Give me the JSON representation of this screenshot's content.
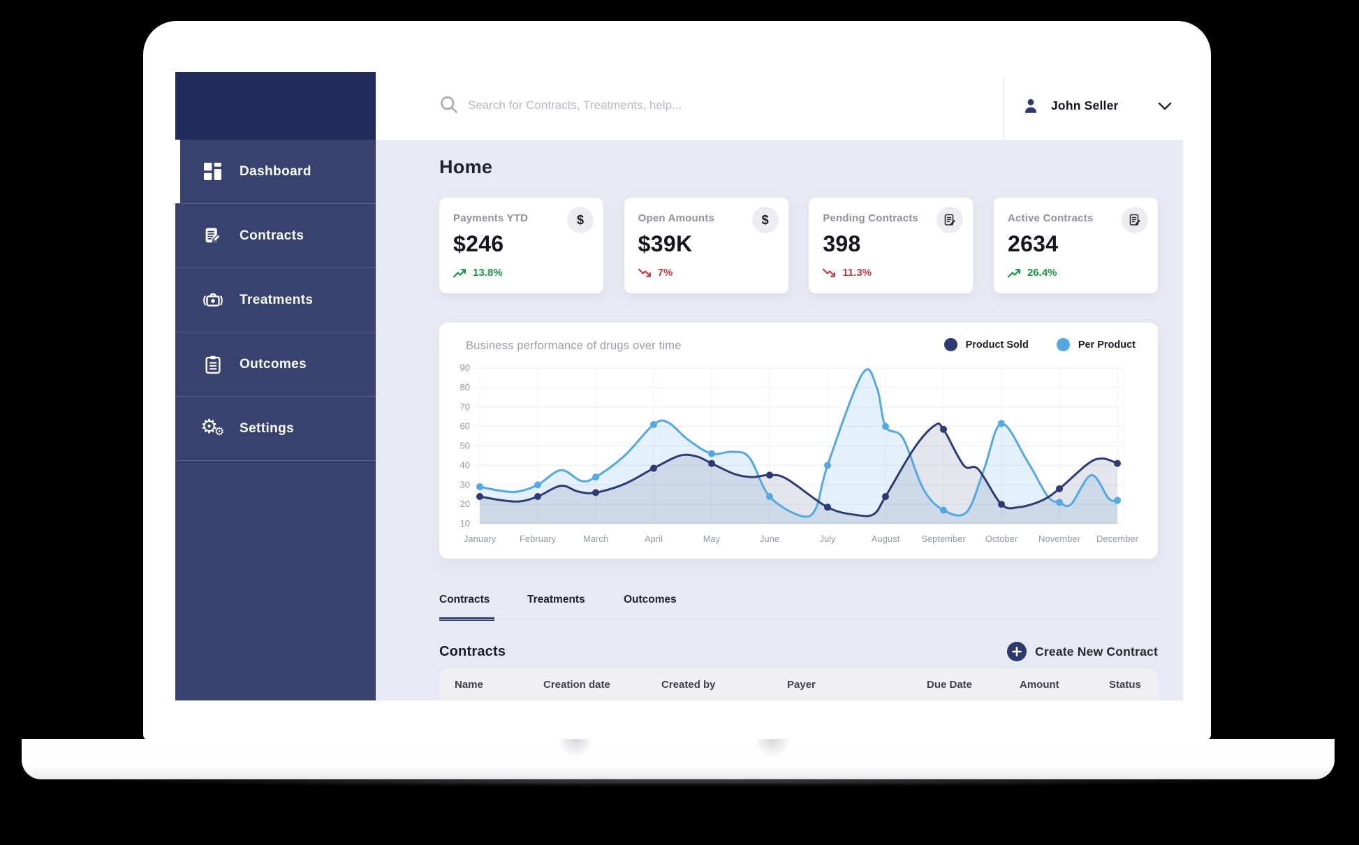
{
  "header": {
    "search_placeholder": "Search for Contracts, Treatments, help...",
    "user_name": "John Seller"
  },
  "sidebar": {
    "items": [
      {
        "label": "Dashboard",
        "icon": "dashboard-grid",
        "active": true
      },
      {
        "label": "Contracts",
        "icon": "contract-edit",
        "active": false
      },
      {
        "label": "Treatments",
        "icon": "medical-bag",
        "active": false
      },
      {
        "label": "Outcomes",
        "icon": "clipboard",
        "active": false
      },
      {
        "label": "Settings",
        "icon": "gears",
        "active": false
      }
    ]
  },
  "page": {
    "title": "Home"
  },
  "stats": [
    {
      "label": "Payments YTD",
      "value": "$246",
      "trend": "13.8%",
      "direction": "up",
      "icon": "dollar-icon"
    },
    {
      "label": "Open Amounts",
      "value": "$39K",
      "trend": "7%",
      "direction": "down",
      "icon": "dollar-icon"
    },
    {
      "label": "Pending Contracts",
      "value": "398",
      "trend": "11.3%",
      "direction": "down",
      "icon": "contract-icon"
    },
    {
      "label": "Active Contracts",
      "value": "2634",
      "trend": "26.4%",
      "direction": "up",
      "icon": "contract-icon"
    }
  ],
  "chart_data": {
    "type": "line",
    "title": "Business performance of drugs over time",
    "xlabel": "",
    "ylabel": "",
    "categories": [
      "January",
      "February",
      "March",
      "April",
      "May",
      "June",
      "July",
      "August",
      "September",
      "October",
      "November",
      "December"
    ],
    "ylim": [
      10,
      90
    ],
    "yticks": [
      10,
      20,
      30,
      40,
      50,
      60,
      70,
      80,
      90
    ],
    "grid": true,
    "legend_position": "top-right",
    "series": [
      {
        "name": "Product Sold",
        "color": "#2e3b72",
        "fill": "rgba(46,59,114,0.13)",
        "values": [
          24,
          24,
          26,
          38.5,
          41,
          35,
          18.5,
          24,
          58.5,
          20,
          28,
          41
        ],
        "shape": [
          [
            0,
            24
          ],
          [
            0.4,
            22
          ],
          [
            0.7,
            21.5
          ],
          [
            1,
            24
          ],
          [
            1.4,
            29.5
          ],
          [
            1.7,
            26.5
          ],
          [
            2,
            26
          ],
          [
            2.5,
            30.5
          ],
          [
            3,
            38.5
          ],
          [
            3.45,
            45
          ],
          [
            3.75,
            44.5
          ],
          [
            4,
            41
          ],
          [
            4.4,
            35.5
          ],
          [
            4.7,
            34
          ],
          [
            5,
            35
          ],
          [
            5.3,
            33
          ],
          [
            6,
            18.5
          ],
          [
            6.5,
            14.5
          ],
          [
            6.8,
            15
          ],
          [
            7,
            24
          ],
          [
            7.5,
            49
          ],
          [
            7.85,
            60.5
          ],
          [
            8,
            58.5
          ],
          [
            8.35,
            40
          ],
          [
            8.6,
            38
          ],
          [
            9,
            20
          ],
          [
            9.3,
            18.5
          ],
          [
            9.7,
            22
          ],
          [
            10,
            28
          ],
          [
            10.5,
            41
          ],
          [
            10.75,
            43.5
          ],
          [
            11,
            41
          ]
        ]
      },
      {
        "name": "Per Product",
        "color": "#54a8e2",
        "fill": "rgba(85,168,226,0.16)",
        "values": [
          29,
          30,
          34,
          61,
          46,
          24,
          40,
          60,
          17,
          61.5,
          21,
          22
        ],
        "shape": [
          [
            0,
            29
          ],
          [
            0.35,
            27
          ],
          [
            0.65,
            26.5
          ],
          [
            1,
            30
          ],
          [
            1.4,
            37.5
          ],
          [
            1.75,
            32
          ],
          [
            2,
            34
          ],
          [
            2.5,
            45
          ],
          [
            3,
            61
          ],
          [
            3.25,
            62
          ],
          [
            3.6,
            53
          ],
          [
            4,
            46
          ],
          [
            4.35,
            47
          ],
          [
            4.65,
            44
          ],
          [
            5,
            24
          ],
          [
            5.55,
            14
          ],
          [
            5.8,
            18
          ],
          [
            6,
            40
          ],
          [
            6.6,
            87
          ],
          [
            6.85,
            80
          ],
          [
            7,
            60
          ],
          [
            7.3,
            54
          ],
          [
            7.65,
            28
          ],
          [
            8,
            17
          ],
          [
            8.4,
            16
          ],
          [
            8.7,
            38
          ],
          [
            9,
            61.5
          ],
          [
            9.45,
            42
          ],
          [
            9.8,
            24
          ],
          [
            10,
            21
          ],
          [
            10.2,
            20
          ],
          [
            10.55,
            35
          ],
          [
            10.85,
            23
          ],
          [
            11,
            22
          ]
        ]
      }
    ]
  },
  "tabs": [
    {
      "label": "Contracts",
      "active": true
    },
    {
      "label": "Treatments",
      "active": false
    },
    {
      "label": "Outcomes",
      "active": false
    }
  ],
  "section": {
    "title": "Contracts",
    "action_label": "Create New Contract"
  },
  "table": {
    "columns": [
      "Name",
      "Creation date",
      "Created by",
      "Payer",
      "Due Date",
      "Amount",
      "Status"
    ]
  },
  "colors": {
    "accent_navy": "#2d3a6e",
    "accent_blue": "#54a8e2",
    "positive_green": "#18953f",
    "negative_red": "#c23a47",
    "sidebar": "#38426f",
    "sidebar_logo": "#1f2b5c",
    "main_background": "#e8eaf3"
  }
}
